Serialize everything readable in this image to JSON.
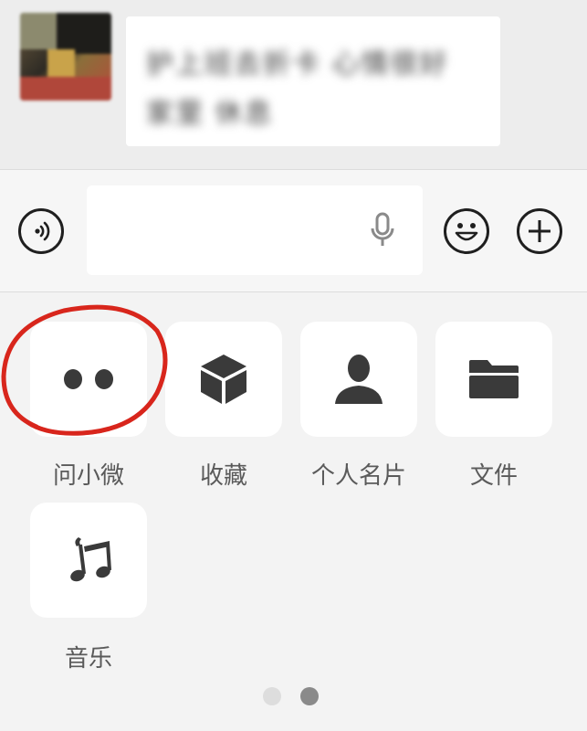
{
  "chat": {
    "message_text": "护上班去折卡 心情很好 家里 休息",
    "avatar_icon": "avatar-image"
  },
  "input_bar": {
    "voice_icon": "voice-icon",
    "mic_icon": "microphone-icon",
    "emoji_icon": "emoji-icon",
    "plus_icon": "plus-icon",
    "text_value": ""
  },
  "panel": {
    "items": [
      {
        "label": "问小微",
        "icon": "wenxiaowei-icon"
      },
      {
        "label": "收藏",
        "icon": "favorites-cube-icon"
      },
      {
        "label": "个人名片",
        "icon": "contact-card-icon"
      },
      {
        "label": "文件",
        "icon": "folder-icon"
      },
      {
        "label": "音乐",
        "icon": "music-icon"
      }
    ],
    "page_indicator": {
      "total": 2,
      "current": 2
    }
  },
  "colors": {
    "background": "#f3f3f3",
    "icon_dark": "#3a3a3a",
    "annotation_red": "#d8261c",
    "dot_active": "#8a8a8a",
    "dot_inactive": "#dddddd"
  }
}
